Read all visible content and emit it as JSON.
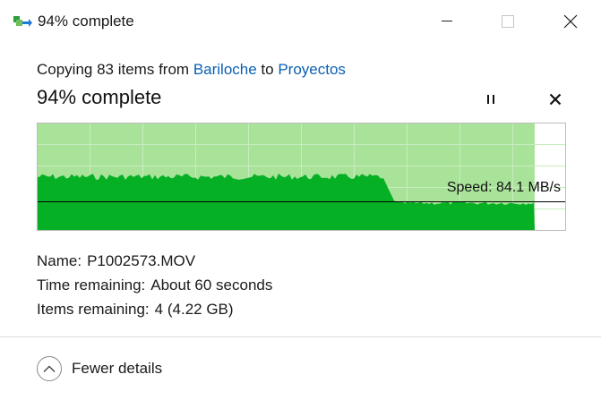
{
  "window": {
    "title": "94% complete",
    "app_icon": "copy-files-icon",
    "controls": [
      "minimize-icon",
      "maximize-icon",
      "close-icon"
    ]
  },
  "summary": {
    "prefix": "Copying 83 items from",
    "source": "Bariloche",
    "connector": "to",
    "destination": "Proyectos",
    "status": "94% complete",
    "pause_icon": "pause-icon",
    "stop_icon": "stop-icon"
  },
  "graph": {
    "progress_fraction": 0.94,
    "speed_label": "Speed: 84.1 MB/s",
    "colors": {
      "done_area": "#a9e39a",
      "speed_area": "#06b025",
      "speed_line": "#000000",
      "grid": "#c8ecc0",
      "border": "#bcbcbc"
    }
  },
  "details": {
    "name_label": "Name:",
    "name_value": "P1002573.MOV",
    "time_label": "Time remaining:",
    "time_value": "About 60 seconds",
    "items_label": "Items remaining:",
    "items_value": "4 (4.22 GB)"
  },
  "footer": {
    "toggle_label": "Fewer details",
    "toggle_icon": "chevron-up-icon"
  }
}
